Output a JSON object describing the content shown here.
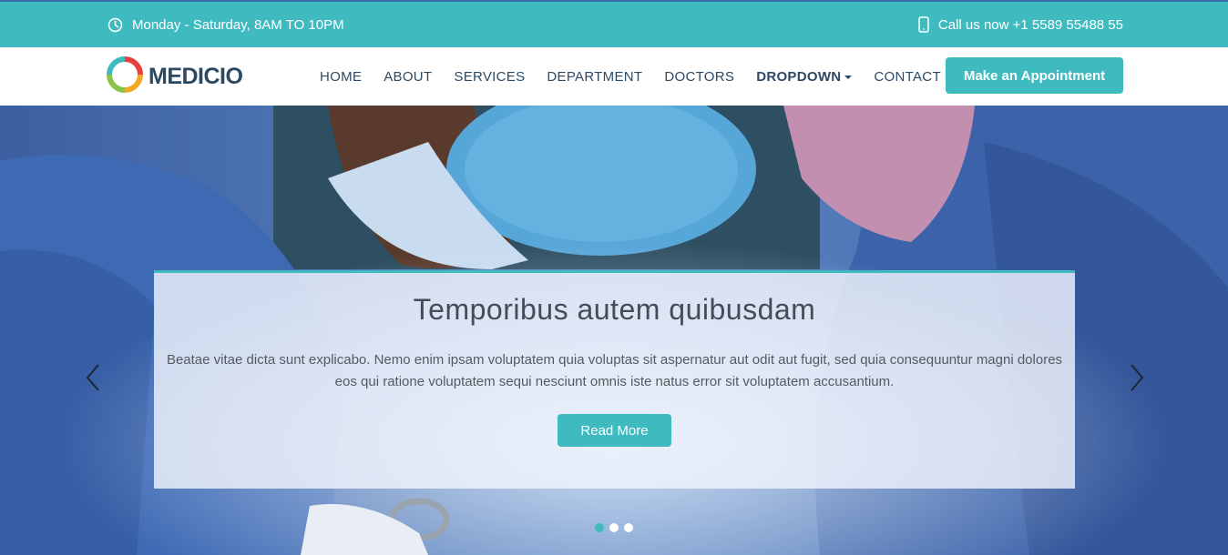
{
  "topbar": {
    "hours": "Monday - Saturday, 8AM TO 10PM",
    "phone": "Call us now +1 5589 55488 55",
    "hours_icon": "clock-icon",
    "phone_icon": "phone-icon"
  },
  "header": {
    "logo_text": "MEDICIO",
    "nav": [
      {
        "label": "HOME"
      },
      {
        "label": "ABOUT"
      },
      {
        "label": "SERVICES"
      },
      {
        "label": "DEPARTMENT"
      },
      {
        "label": "DOCTORS"
      },
      {
        "label": "DROPDOWN"
      },
      {
        "label": "CONTACT"
      }
    ],
    "appointment_label": "Make an Appointment"
  },
  "hero": {
    "title": "Temporibus autem quibusdam",
    "text": "Beatae vitae dicta sunt explicabo. Nemo enim ipsam voluptatem quia voluptas sit aspernatur aut odit aut fugit, sed quia consequuntur magni dolores eos qui ratione voluptatem sequi nesciunt omnis iste natus error sit voluptatem accusantium.",
    "button_label": "Read More",
    "slide_count": 3,
    "active_slide": 1
  },
  "colors": {
    "accent": "#3fbbc0",
    "nav_text": "#2c4964"
  }
}
